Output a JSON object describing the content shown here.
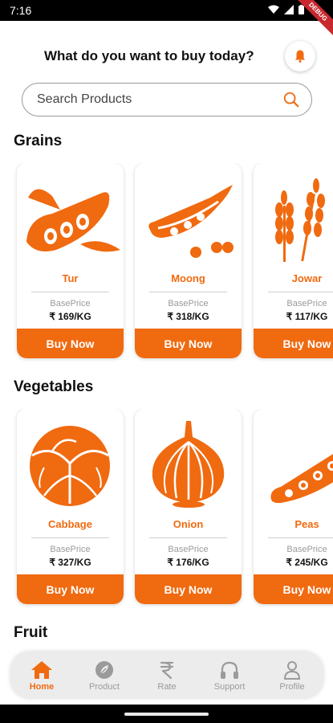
{
  "status_bar": {
    "time": "7:16",
    "debug_label": "DEBUG"
  },
  "header": {
    "title": "What do you want to buy today?"
  },
  "search": {
    "placeholder": "Search Products"
  },
  "sections": [
    {
      "title": "Grains",
      "items": [
        {
          "name": "Tur",
          "base_label": "BasePrice",
          "price": "₹ 169/KG",
          "button": "Buy Now",
          "icon": "tur-dal-icon"
        },
        {
          "name": "Moong",
          "base_label": "BasePrice",
          "price": "₹ 318/KG",
          "button": "Buy Now",
          "icon": "moong-pod-icon"
        },
        {
          "name": "Jowar",
          "base_label": "BasePrice",
          "price": "₹ 117/KG",
          "button": "Buy Now",
          "icon": "wheat-icon"
        }
      ]
    },
    {
      "title": "Vegetables",
      "items": [
        {
          "name": "Cabbage",
          "base_label": "BasePrice",
          "price": "₹ 327/KG",
          "button": "Buy Now",
          "icon": "cabbage-icon"
        },
        {
          "name": "Onion",
          "base_label": "BasePrice",
          "price": "₹ 176/KG",
          "button": "Buy Now",
          "icon": "onion-icon"
        },
        {
          "name": "Peas",
          "base_label": "BasePrice",
          "price": "₹ 245/KG",
          "button": "Buy Now",
          "icon": "peas-pod-icon"
        }
      ]
    },
    {
      "title": "Fruit",
      "items": []
    }
  ],
  "nav": {
    "items": [
      {
        "label": "Home",
        "icon": "home-icon",
        "active": true
      },
      {
        "label": "Product",
        "icon": "leaf-icon",
        "active": false
      },
      {
        "label": "Rate",
        "icon": "rupee-icon",
        "active": false
      },
      {
        "label": "Support",
        "icon": "headphones-icon",
        "active": false
      },
      {
        "label": "Profile",
        "icon": "person-icon",
        "active": false
      }
    ]
  },
  "colors": {
    "accent": "#f06a10",
    "inactive": "#9a9a9a",
    "nav_bg": "#ececec"
  }
}
